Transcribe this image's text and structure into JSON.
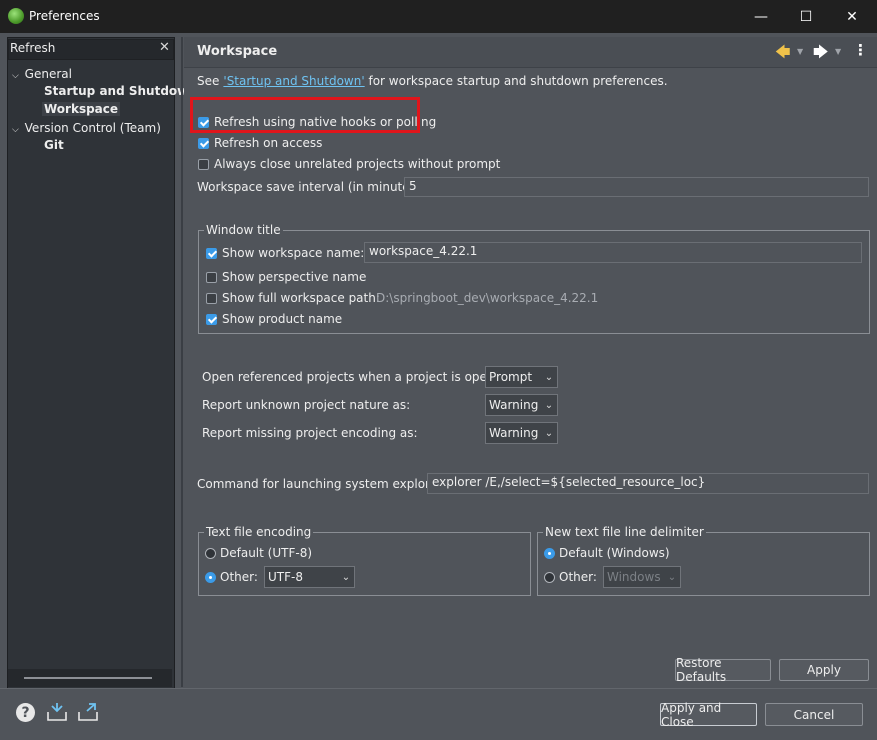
{
  "window": {
    "title": "Preferences",
    "minimize": "—",
    "maximize": "☐",
    "close": "✕"
  },
  "filter": {
    "value": "Refresh",
    "clear_icon": "✕"
  },
  "tree": {
    "general": {
      "label": "General",
      "arrow": "v"
    },
    "startup": {
      "label": "Startup and Shutdown"
    },
    "workspace": {
      "label": "Workspace"
    },
    "vcs": {
      "label": "Version Control (Team)",
      "arrow": "v"
    },
    "git": {
      "label": "Git"
    }
  },
  "page": {
    "title": "Workspace",
    "see_prefix": "See ",
    "see_link": "'Startup and Shutdown'",
    "see_suffix": " for workspace startup and shutdown preferences."
  },
  "options": {
    "refresh_native": {
      "label": "Refresh using native hooks or polling",
      "checked": true
    },
    "refresh_access": {
      "label": "Refresh on access",
      "checked": true
    },
    "always_close": {
      "label": "Always close unrelated projects without prompt",
      "checked": false
    },
    "save_interval": {
      "label": "Workspace save interval (in minutes):",
      "value": "5"
    }
  },
  "window_title_group": {
    "label": "Window title",
    "show_ws_name": {
      "label": "Show workspace name:",
      "checked": true,
      "value": "workspace_4.22.1"
    },
    "show_perspective": {
      "label": "Show perspective name",
      "checked": false
    },
    "show_full_path": {
      "label": "Show full workspace path:",
      "checked": false,
      "value": "D:\\springboot_dev\\workspace_4.22.1"
    },
    "show_product": {
      "label": "Show product name",
      "checked": true
    }
  },
  "project_opts": {
    "open_referenced": {
      "label": "Open referenced projects when a project is opened:",
      "value": "Prompt"
    },
    "unknown_nature": {
      "label": "Report unknown project nature as:",
      "value": "Warning"
    },
    "missing_encoding": {
      "label": "Report missing project encoding as:",
      "value": "Warning"
    }
  },
  "explorer": {
    "label": "Command for launching system explorer:",
    "value": "explorer /E,/select=${selected_resource_loc}"
  },
  "encoding_group": {
    "label": "Text file encoding",
    "default_label": "Default (UTF-8)",
    "other_label": "Other:",
    "other_value": "UTF-8",
    "selected": "other"
  },
  "delimiter_group": {
    "label": "New text file line delimiter",
    "default_label": "Default (Windows)",
    "other_label": "Other:",
    "other_value": "Windows",
    "selected": "default"
  },
  "buttons": {
    "restore_defaults": "Restore Defaults",
    "apply": "Apply",
    "apply_close": "Apply and Close",
    "cancel": "Cancel"
  },
  "icons": {
    "help": "help-icon",
    "import": "import-icon",
    "export": "export-icon",
    "back": "arrow-left-icon",
    "forward": "arrow-right-icon",
    "menu": "view-menu-icon"
  }
}
